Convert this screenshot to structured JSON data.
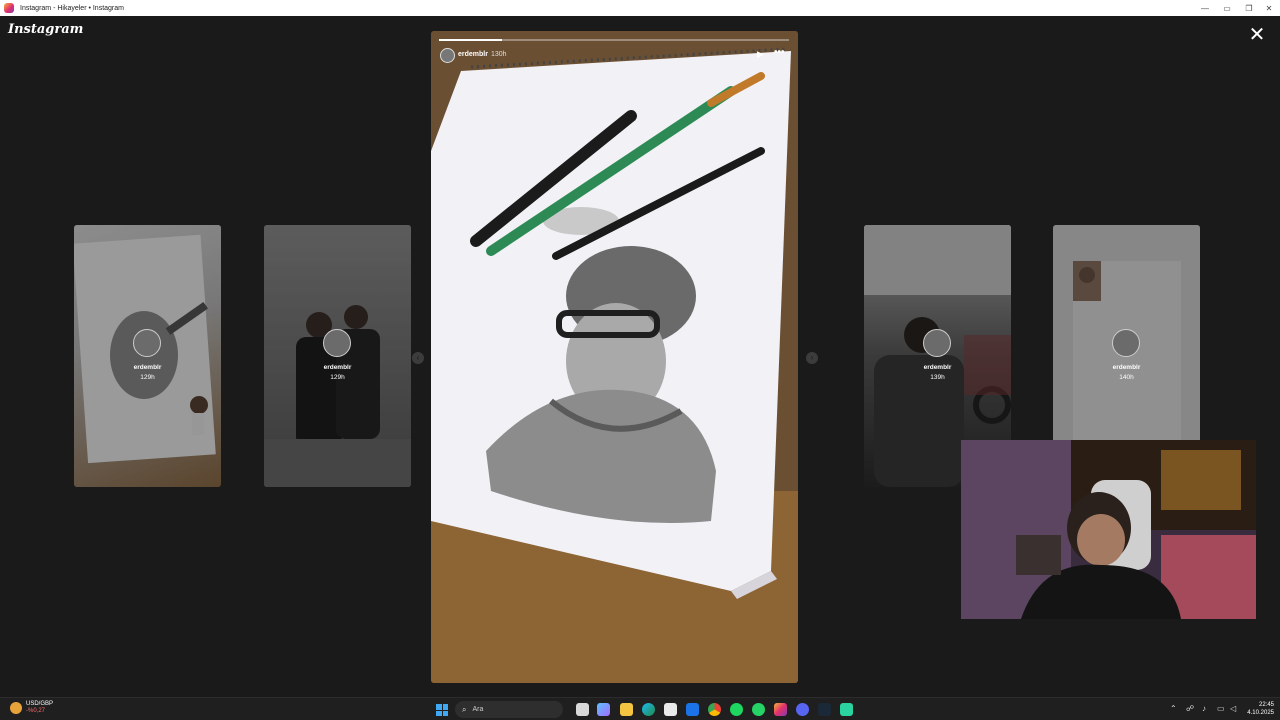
{
  "window": {
    "title": "Instagram - Hikayeler • Instagram"
  },
  "header": {
    "logo": "Instagram"
  },
  "previews_left": [
    {
      "username": "erdemblr",
      "time": "129h"
    },
    {
      "username": "erdemblr",
      "time": "129h"
    }
  ],
  "previews_right": [
    {
      "username": "erdemblr",
      "time": "139h"
    },
    {
      "username": "erdemblr",
      "time": "140h"
    }
  ],
  "story": {
    "username": "erdemblr",
    "time": "130h",
    "progress": 0.18
  },
  "taskbar": {
    "widget_name": "USD/GBP",
    "widget_change": "-%0,27",
    "search_placeholder": "Ara",
    "time": "22:45",
    "date": "4.10.2025"
  },
  "colors": {
    "accent": "#e1306c",
    "background": "#1a1a1a"
  }
}
